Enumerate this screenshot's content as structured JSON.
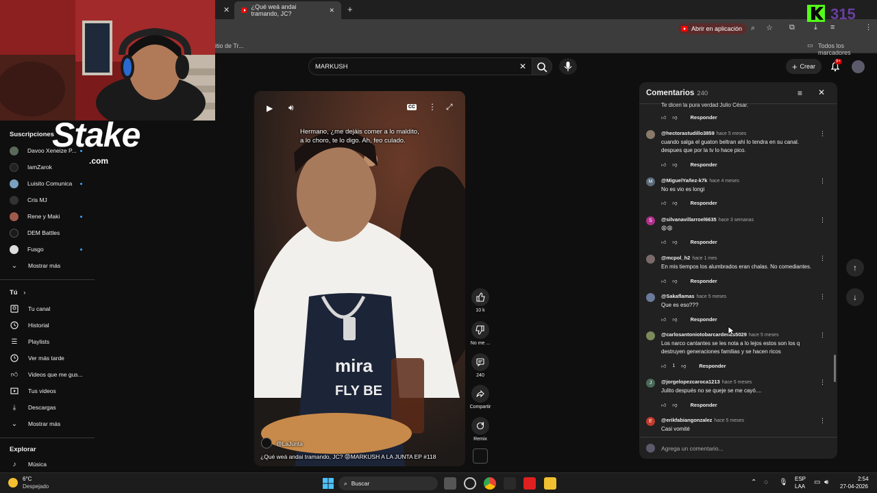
{
  "browser": {
    "tab_title": "¿Qué weá andai tramando, JC?",
    "bookmark_left": "itio de Tr...",
    "open_app_label": "Abrir en aplicación",
    "all_bookmarks": "Todos los marcadores"
  },
  "stake": {
    "logo": "Stake",
    "domain": ".com"
  },
  "corner_logo": {
    "text": "K315"
  },
  "sidebar": {
    "subscriptions_title": "Suscripciones",
    "subscriptions": [
      {
        "label": "Davoo Xeneize P...",
        "color": "#5a6a5a",
        "dot": true
      },
      {
        "label": "IamZarok",
        "color": "#222222",
        "dot": false
      },
      {
        "label": "Luisito Comunica",
        "color": "#7aa0c0",
        "dot": true
      },
      {
        "label": "Cris MJ",
        "color": "#333333",
        "dot": false
      },
      {
        "label": "Rene y Maki",
        "color": "#a05a4a",
        "dot": true
      },
      {
        "label": "DEM Battles",
        "color": "#1a1a1a",
        "dot": false
      },
      {
        "label": "Fusgo",
        "color": "#dddddd",
        "dot": true
      }
    ],
    "show_more_1": "Mostrar más",
    "you_title": "Tú",
    "you_items": [
      {
        "label": "Tu canal",
        "icon": "channel-icon"
      },
      {
        "label": "Historial",
        "icon": "history-icon"
      },
      {
        "label": "Playlists",
        "icon": "playlists-icon"
      },
      {
        "label": "Ver más tarde",
        "icon": "watch-later-icon"
      },
      {
        "label": "Videos que me gus...",
        "icon": "like-icon"
      },
      {
        "label": "Tus videos",
        "icon": "your-videos-icon"
      },
      {
        "label": "Descargas",
        "icon": "download-icon"
      }
    ],
    "show_more_2": "Mostrar más",
    "explore_title": "Explorar",
    "explore_items": [
      {
        "label": "Música",
        "icon": "music-icon"
      }
    ]
  },
  "masthead": {
    "search_value": "MARKUSH",
    "create_label": "Crear",
    "notif_badge": "9+"
  },
  "video": {
    "subtitle_line1": "Hermano, ¿me dejáis comer a lo maldito,",
    "subtitle_line2": "a lo choro, te lo digo. Ah, feo culado.",
    "channel": "@LaJunta",
    "title": "¿Qué weá andai tramando, JC? 😡MARKUSH A LA JUNTA EP #118"
  },
  "actions": {
    "like_count": "10 k",
    "dislike_label": "No me ...",
    "comments_count": "240",
    "share_label": "Compartir",
    "remix_label": "Remix"
  },
  "comments": {
    "title": "Comentarios",
    "count": "240",
    "reply_label": "Responder",
    "top_partial": "Te dicen la pura verdad Julio César.",
    "input_placeholder": "Agrega un comentario...",
    "items": [
      {
        "author": "@hectorastudillo3859",
        "time": "hace 5 meses",
        "text": "cuando salga el guaton beltran ahi lo tendra en su canal. despues que por la tv lo hace pico.",
        "likes": "",
        "avatar_letter": "",
        "avatar_color": "#8a7a6a"
      },
      {
        "author": "@MiguelYañez-k7k",
        "time": "hace 4 meses",
        "text": "No es  vio es longi",
        "likes": "",
        "avatar_letter": "M",
        "avatar_color": "#5a6a7a"
      },
      {
        "author": "@silvanavillarroel6635",
        "time": "hace 3 semanas",
        "text": "😩😩",
        "likes": "",
        "avatar_letter": "S",
        "avatar_color": "#b0308a"
      },
      {
        "author": "@mcpol_h2",
        "time": "hace 1 mes",
        "text": "En mis tiempos los alumbrados  eran chalas. No comediantes.",
        "likes": "",
        "avatar_letter": "",
        "avatar_color": "#7a6a6a"
      },
      {
        "author": "@Sakaflamas",
        "time": "hace 5 meses",
        "text": "Que es eso???",
        "likes": "",
        "avatar_letter": "",
        "avatar_color": "#6a7a9a"
      },
      {
        "author": "@carlosantoniotobarcardenas5029",
        "time": "hace 5 meses",
        "text": "Los narco cantantes se les nota a lo lejos estos son los q destruyen generaciones familias y se hacen ricos",
        "likes": "1",
        "avatar_letter": "",
        "avatar_color": "#7a8a5a"
      },
      {
        "author": "@jorgelopezcaroca1213",
        "time": "hace 5 meses",
        "text": "Julito después no se queje se me cayó....",
        "likes": "",
        "avatar_letter": "J",
        "avatar_color": "#4a6a5a"
      },
      {
        "author": "@erikfabiangonzalez",
        "time": "hace 5 meses",
        "text": "Casi vomité",
        "likes": "",
        "avatar_letter": "E",
        "avatar_color": "#c0392b"
      }
    ]
  },
  "taskbar": {
    "weather_temp": "6°C",
    "weather_desc": "Despejado",
    "search_label": "Buscar",
    "lang": "ESP",
    "lang2": "LAA",
    "time": "2:54",
    "date": "27-04-2026"
  }
}
